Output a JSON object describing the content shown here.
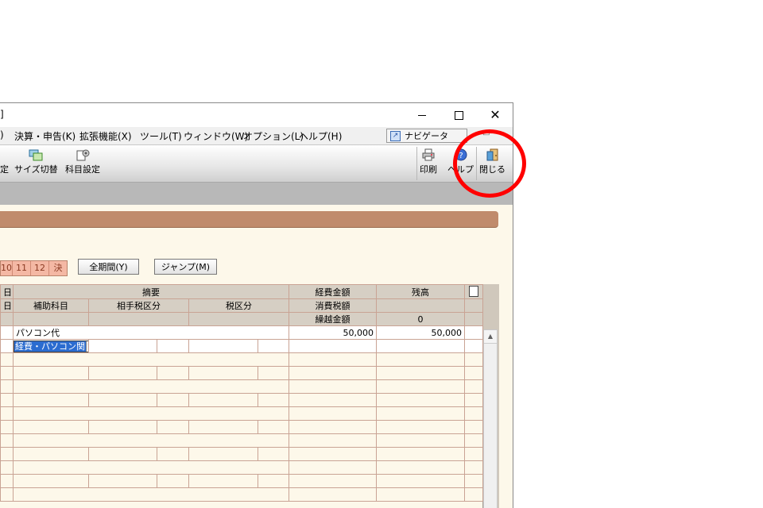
{
  "window": {
    "title_fragment": "]",
    "controls": {
      "minimize": "–",
      "maximize": "☐",
      "close": "✕"
    }
  },
  "menu": {
    "items": [
      {
        "label": ")"
      },
      {
        "label": "決算・申告(K)"
      },
      {
        "label": "拡張機能(X)"
      },
      {
        "label": "ツール(T)"
      },
      {
        "label": "ウィンドウ(W)"
      },
      {
        "label": "オプション(L)"
      },
      {
        "label": "ヘルプ(H)"
      }
    ],
    "navigator_label": "ナビゲータ"
  },
  "toolbar": {
    "left_fragment": "定",
    "size_switch": "サイズ切替",
    "account_settings": "科目設定",
    "print": "印刷",
    "help": "ヘルプ",
    "close": "閉じる"
  },
  "period": {
    "months": [
      "10",
      "11",
      "12",
      "決"
    ],
    "all_period_button": "全期間(Y)",
    "jump_button": "ジャンプ(M)"
  },
  "grid": {
    "header_row1": {
      "col0": "日",
      "summary": "摘要",
      "expense_amount": "経費金額",
      "balance": "残高"
    },
    "header_row2": {
      "col0": "日",
      "sub_account": "補助科目",
      "partner_tax": "相手税区分",
      "tax_category": "税区分",
      "consumption_tax": "消費税額"
    },
    "header_row3": {
      "carryover_label": "繰越金額",
      "carryover_value": "0"
    },
    "rows": [
      {
        "summary": "パソコン代",
        "expense_amount": "50,000",
        "balance": "50,000",
        "account_select": "経費・パソコン関"
      }
    ]
  },
  "colors": {
    "accent_band": "#c08b6c",
    "highlight": "#ff0000",
    "selection": "#2b6cd0"
  }
}
